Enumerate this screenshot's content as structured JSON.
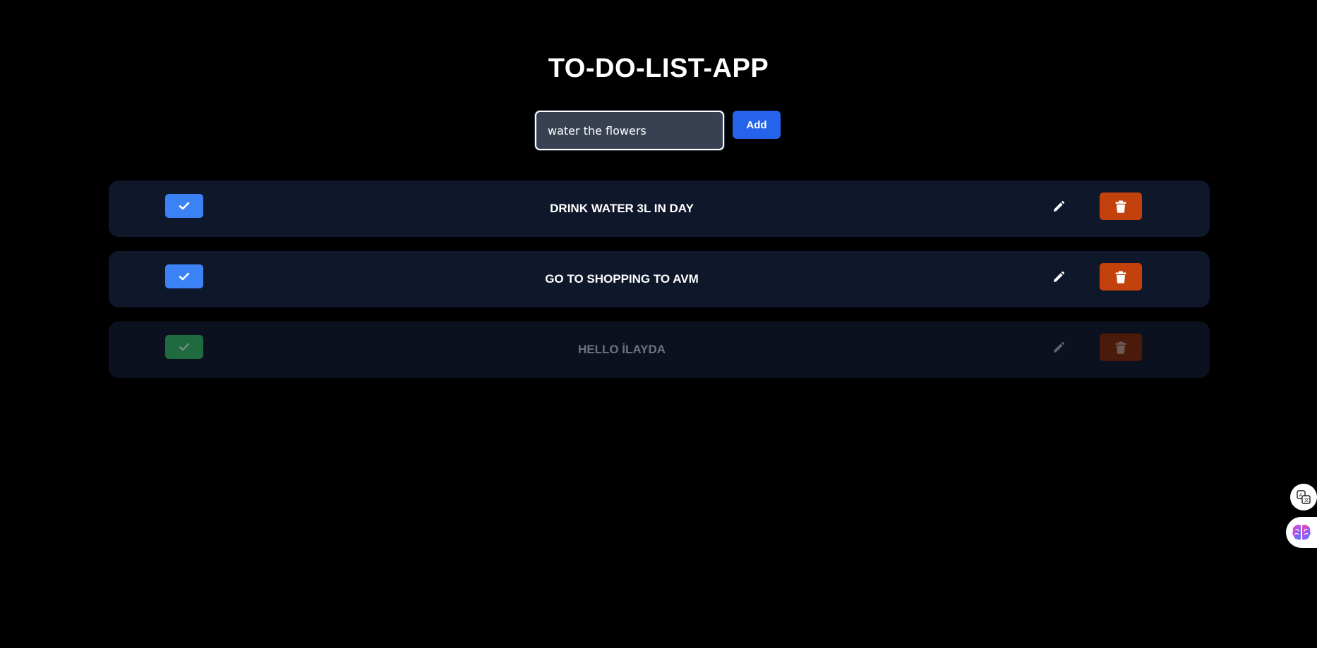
{
  "app": {
    "title": "TO-DO-LIST-APP"
  },
  "form": {
    "input_value": "water the flowers",
    "add_label": "Add"
  },
  "todos": [
    {
      "text": "DRINK WATER 3L IN DAY",
      "completed": false
    },
    {
      "text": "GO TO SHOPPING TO AVM",
      "completed": false
    },
    {
      "text": "HELLO İLAYDA",
      "completed": true
    }
  ],
  "icons": {
    "check": "check-icon",
    "edit": "pencil-icon",
    "delete": "trash-icon",
    "translate": "translate-icon",
    "brain": "brain-icon"
  },
  "colors": {
    "background": "#000000",
    "row": "#0f172a",
    "check_active": "#3b82f6",
    "check_done": "#1f6a3e",
    "delete": "#c2410c",
    "add": "#2563eb"
  }
}
